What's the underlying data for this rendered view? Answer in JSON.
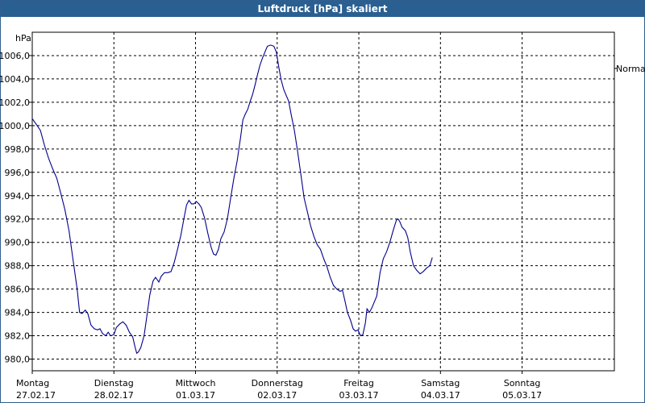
{
  "window": {
    "title": "Luftdruck [hPa] skaliert"
  },
  "chart_data": {
    "type": "line",
    "title": "Luftdruck [hPa] skaliert",
    "ylabel": "hPa",
    "ylim": [
      979,
      1008
    ],
    "xlim": [
      0,
      7.13
    ],
    "grid": true,
    "reference_label": "Normal",
    "reference_value": 1004.9,
    "y_ticks": [
      "980,0",
      "982,0",
      "984,0",
      "986,0",
      "988,0",
      "990,0",
      "992,0",
      "994,0",
      "996,0",
      "998,0",
      "1000,0",
      "1002,0",
      "1004,0",
      "1006,0"
    ],
    "x_ticks": [
      {
        "x": 0,
        "day": "Montag",
        "date": "27.02.17"
      },
      {
        "x": 1,
        "day": "Dienstag",
        "date": "28.02.17"
      },
      {
        "x": 2,
        "day": "Mittwoch",
        "date": "01.03.17"
      },
      {
        "x": 3,
        "day": "Donnerstag",
        "date": "02.03.17"
      },
      {
        "x": 4,
        "day": "Freitag",
        "date": "03.03.17"
      },
      {
        "x": 5,
        "day": "Samstag",
        "date": "04.03.17"
      },
      {
        "x": 6,
        "day": "Sonntag",
        "date": "05.03.17"
      }
    ],
    "series": [
      {
        "color": "#00008b",
        "points": [
          [
            0.0,
            1000.6
          ],
          [
            0.05,
            1000.1
          ],
          [
            0.1,
            999.6
          ],
          [
            0.15,
            998.3
          ],
          [
            0.2,
            997.2
          ],
          [
            0.25,
            996.3
          ],
          [
            0.3,
            995.5
          ],
          [
            0.35,
            994.2
          ],
          [
            0.4,
            992.8
          ],
          [
            0.45,
            991.0
          ],
          [
            0.5,
            988.5
          ],
          [
            0.55,
            986.0
          ],
          [
            0.58,
            984.0
          ],
          [
            0.61,
            983.9
          ],
          [
            0.65,
            984.2
          ],
          [
            0.68,
            983.9
          ],
          [
            0.72,
            982.9
          ],
          [
            0.76,
            982.6
          ],
          [
            0.8,
            982.5
          ],
          [
            0.83,
            982.6
          ],
          [
            0.86,
            982.2
          ],
          [
            0.9,
            982.0
          ],
          [
            0.93,
            982.3
          ],
          [
            0.96,
            982.0
          ],
          [
            1.0,
            982.1
          ],
          [
            1.03,
            982.7
          ],
          [
            1.07,
            983.0
          ],
          [
            1.11,
            983.2
          ],
          [
            1.15,
            982.9
          ],
          [
            1.19,
            982.3
          ],
          [
            1.23,
            981.9
          ],
          [
            1.26,
            981.0
          ],
          [
            1.28,
            980.5
          ],
          [
            1.3,
            980.6
          ],
          [
            1.33,
            981.0
          ],
          [
            1.37,
            982.0
          ],
          [
            1.4,
            983.5
          ],
          [
            1.44,
            985.5
          ],
          [
            1.48,
            986.7
          ],
          [
            1.51,
            987.0
          ],
          [
            1.55,
            986.6
          ],
          [
            1.58,
            987.1
          ],
          [
            1.62,
            987.4
          ],
          [
            1.66,
            987.4
          ],
          [
            1.7,
            987.5
          ],
          [
            1.74,
            988.3
          ],
          [
            1.78,
            989.4
          ],
          [
            1.82,
            990.6
          ],
          [
            1.86,
            992.1
          ],
          [
            1.89,
            993.2
          ],
          [
            1.92,
            993.6
          ],
          [
            1.95,
            993.3
          ],
          [
            1.98,
            993.3
          ],
          [
            2.01,
            993.5
          ],
          [
            2.04,
            993.3
          ],
          [
            2.07,
            993.0
          ],
          [
            2.11,
            992.1
          ],
          [
            2.15,
            990.8
          ],
          [
            2.19,
            989.6
          ],
          [
            2.22,
            989.0
          ],
          [
            2.25,
            988.9
          ],
          [
            2.28,
            989.4
          ],
          [
            2.31,
            990.3
          ],
          [
            2.35,
            990.9
          ],
          [
            2.39,
            992.0
          ],
          [
            2.43,
            993.8
          ],
          [
            2.47,
            995.5
          ],
          [
            2.51,
            997.0
          ],
          [
            2.55,
            998.9
          ],
          [
            2.58,
            1000.5
          ],
          [
            2.61,
            1001.0
          ],
          [
            2.64,
            1001.4
          ],
          [
            2.67,
            1002.1
          ],
          [
            2.7,
            1002.7
          ],
          [
            2.73,
            1003.5
          ],
          [
            2.76,
            1004.4
          ],
          [
            2.79,
            1005.2
          ],
          [
            2.82,
            1005.8
          ],
          [
            2.85,
            1006.3
          ],
          [
            2.88,
            1006.8
          ],
          [
            2.92,
            1006.9
          ],
          [
            2.96,
            1006.8
          ],
          [
            2.99,
            1006.3
          ],
          [
            3.02,
            1005.0
          ],
          [
            3.05,
            1003.9
          ],
          [
            3.08,
            1003.1
          ],
          [
            3.11,
            1002.6
          ],
          [
            3.14,
            1002.1
          ],
          [
            3.17,
            1001.0
          ],
          [
            3.21,
            999.6
          ],
          [
            3.25,
            997.8
          ],
          [
            3.29,
            995.8
          ],
          [
            3.33,
            993.8
          ],
          [
            3.37,
            992.6
          ],
          [
            3.41,
            991.4
          ],
          [
            3.45,
            990.5
          ],
          [
            3.49,
            989.8
          ],
          [
            3.53,
            989.4
          ],
          [
            3.57,
            988.6
          ],
          [
            3.61,
            987.9
          ],
          [
            3.65,
            987.0
          ],
          [
            3.69,
            986.3
          ],
          [
            3.73,
            986.0
          ],
          [
            3.77,
            985.8
          ],
          [
            3.8,
            985.9
          ],
          [
            3.83,
            985.0
          ],
          [
            3.86,
            984.0
          ],
          [
            3.9,
            983.3
          ],
          [
            3.93,
            982.6
          ],
          [
            3.96,
            982.4
          ],
          [
            3.99,
            982.5
          ],
          [
            4.02,
            982.0
          ],
          [
            4.05,
            982.1
          ],
          [
            4.08,
            983.1
          ],
          [
            4.1,
            984.3
          ],
          [
            4.13,
            984.0
          ],
          [
            4.16,
            984.4
          ],
          [
            4.19,
            984.9
          ],
          [
            4.22,
            985.4
          ],
          [
            4.26,
            987.4
          ],
          [
            4.3,
            988.6
          ],
          [
            4.34,
            989.2
          ],
          [
            4.38,
            990.0
          ],
          [
            4.42,
            991.0
          ],
          [
            4.46,
            991.9
          ],
          [
            4.48,
            992.0
          ],
          [
            4.5,
            991.8
          ],
          [
            4.53,
            991.3
          ],
          [
            4.57,
            991.0
          ],
          [
            4.6,
            990.4
          ],
          [
            4.63,
            989.2
          ],
          [
            4.67,
            988.0
          ],
          [
            4.71,
            987.6
          ],
          [
            4.75,
            987.3
          ],
          [
            4.79,
            987.5
          ],
          [
            4.83,
            987.8
          ],
          [
            4.87,
            988.0
          ],
          [
            4.9,
            988.7
          ]
        ]
      }
    ]
  }
}
